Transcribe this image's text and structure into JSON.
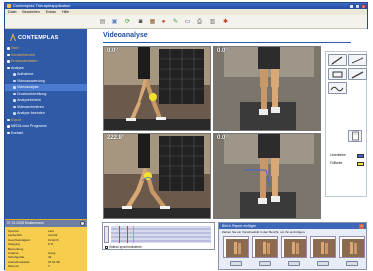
{
  "window": {
    "title": "Contemplas Therapieapplikation"
  },
  "menu": {
    "items": [
      "Datei",
      "Bearbeiten",
      "Extras",
      "Hilfe"
    ]
  },
  "toolbar": {
    "icons": [
      "open-icon",
      "save-icon",
      "refresh-icon",
      "camera-icon",
      "film-icon",
      "record-icon",
      "settings-icon",
      "export-icon",
      "print-icon",
      "notes-icon",
      "help-icon"
    ]
  },
  "sidebar": {
    "logo": "CONTEMPLAS",
    "nav": [
      {
        "label": "Start",
        "level": 1
      },
      {
        "label": "Kundenbereich",
        "level": 1
      },
      {
        "label": "Probandendaten",
        "level": 1
      },
      {
        "label": "Analyse",
        "level": 1,
        "active": true
      },
      {
        "label": "Aufnahme",
        "level": 2
      },
      {
        "label": "Videoauswertung",
        "level": 2
      },
      {
        "label": "Videoanalyse",
        "level": 2,
        "active": true
      },
      {
        "label": "Druckvorbereitung",
        "level": 2
      },
      {
        "label": "Analysebericht",
        "level": 2
      },
      {
        "label": "Videoarchivieren",
        "level": 2
      },
      {
        "label": "Analyse beenden",
        "level": 2
      },
      {
        "label": "Export",
        "level": 1
      },
      {
        "label": "MEDA zum Programm",
        "level": 1
      },
      {
        "label": "Kontakt",
        "level": 1
      }
    ]
  },
  "info_panel": {
    "title": "07.01.2008 Mustermann",
    "rows": [
      {
        "k": "Sportart",
        "v": "Lauf"
      },
      {
        "k": "Laufschuh",
        "v": "neutral"
      },
      {
        "k": "Geschwindigkeit",
        "v": "10 km/h"
      },
      {
        "k": "Steigung",
        "v": "0 %"
      },
      {
        "k": "Bemerkung",
        "v": ""
      },
      {
        "k": "Analyse",
        "v": "Gang"
      },
      {
        "k": "Schuhgröße",
        "v": "42"
      },
      {
        "k": "Aufnahmedatum",
        "v": "07.01.08"
      },
      {
        "k": "Kamera",
        "v": "4"
      }
    ]
  },
  "main": {
    "title": "Videoanalyse",
    "videos": [
      {
        "angle": "0.0°"
      },
      {
        "angle": "0.0°"
      },
      {
        "angle": "222.8°"
      },
      {
        "angle": "0.0°"
      }
    ]
  },
  "tools": {
    "buttons": [
      "pen-icon",
      "line-icon",
      "rectangle-icon",
      "pencil-icon",
      "curve-icon",
      "page-icon"
    ],
    "legend": [
      {
        "label": "Linienfarbe",
        "color": "#3f62d9"
      },
      {
        "label": "Füllfarbe",
        "color": "#f3e33b"
      }
    ]
  },
  "timeline": {
    "checkbox_label": "Videos synchronisieren",
    "checked": true
  },
  "thumbs": {
    "title": "Bild in Report einfügen",
    "hint": "Ziehen Sie ein Vorschaubild in den Bericht, um ihn einzufügen.",
    "count": 5
  },
  "colors": {
    "sidebar": "#2f5aa8",
    "info": "#f6cd4c",
    "accent": "#1e4ea2"
  }
}
